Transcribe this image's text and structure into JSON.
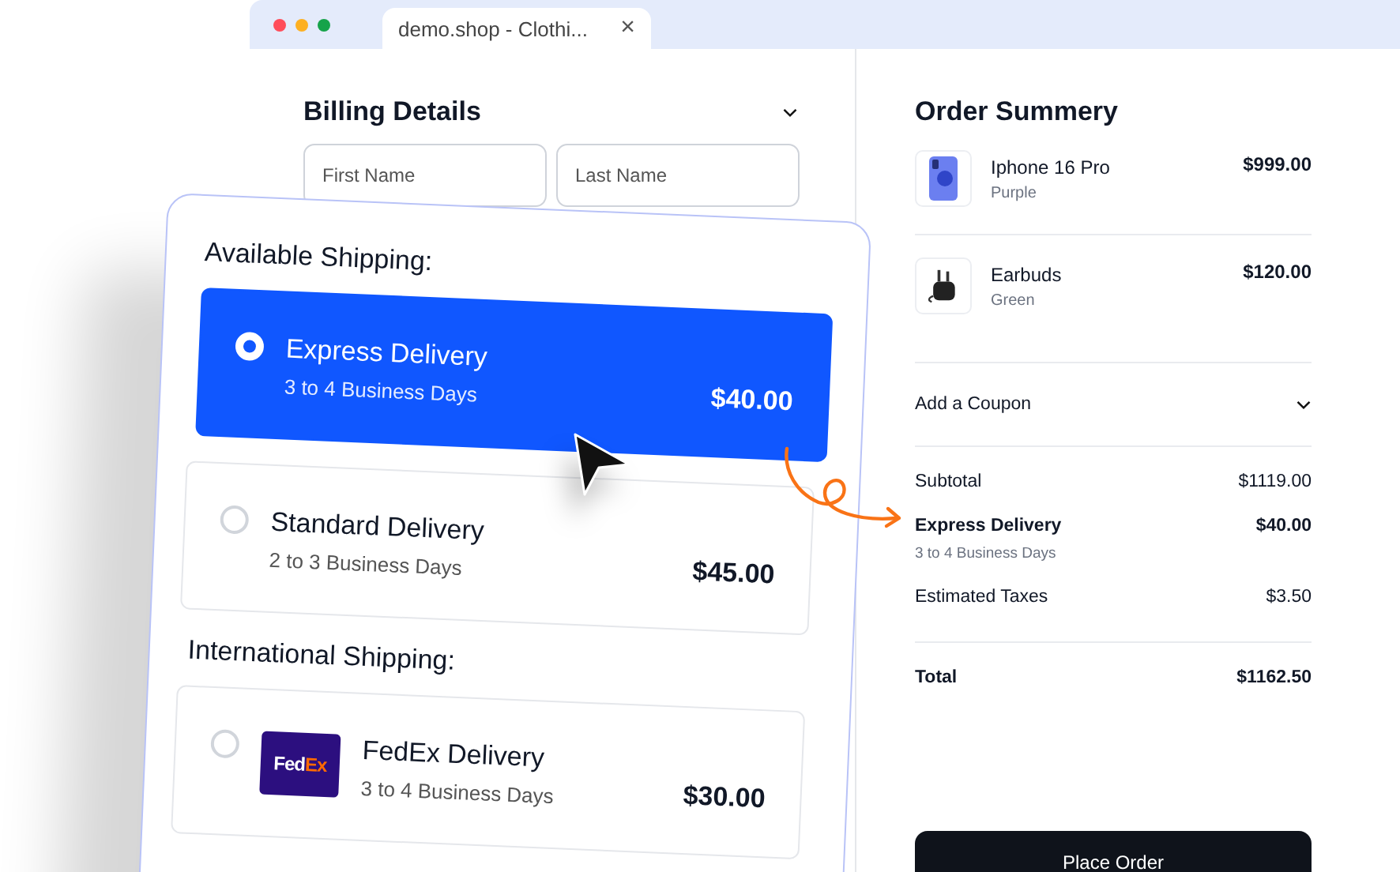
{
  "browser_tab": {
    "title": "demo.shop - Clothi...",
    "close": "×"
  },
  "billing": {
    "title": "Billing Details",
    "fields": [
      {
        "placeholder": "First Name"
      },
      {
        "placeholder": "Last Name"
      }
    ]
  },
  "shipping_groups": [
    {
      "heading": "Available Shipping:",
      "options": [
        {
          "name": "Express Delivery",
          "days": "3 to 4 Business Days",
          "price": "$40.00",
          "selected": true
        },
        {
          "name": "Standard Delivery",
          "days": "2 to 3 Business Days",
          "price": "$45.00",
          "selected": false
        }
      ]
    },
    {
      "heading": "International Shipping:",
      "options": [
        {
          "name": "FedEx Delivery",
          "days": "3 to 4 Business Days",
          "price": "$30.00",
          "selected": false,
          "logo": [
            "Fed",
            "Ex"
          ]
        }
      ]
    }
  ],
  "summary": {
    "title": "Order Summery",
    "items": [
      {
        "kind": "phone",
        "name": "Iphone 16 Pro",
        "variant": "Purple",
        "price": "$999.00"
      },
      {
        "kind": "earbuds",
        "name": "Earbuds",
        "variant": "Green",
        "price": "$120.00"
      }
    ],
    "coupon": "Add a Coupon",
    "lines": [
      {
        "kind": "plain",
        "label": "Subtotal",
        "value": "$1119.00"
      },
      {
        "kind": "shipping",
        "label": "Express Delivery",
        "value": "$40.00",
        "note": "3 to 4 Business Days"
      },
      {
        "kind": "plain",
        "label": "Estimated Taxes",
        "value": "$3.50"
      },
      {
        "kind": "total",
        "label": "Total",
        "value": "$1162.50"
      }
    ],
    "button": "Place Order"
  }
}
